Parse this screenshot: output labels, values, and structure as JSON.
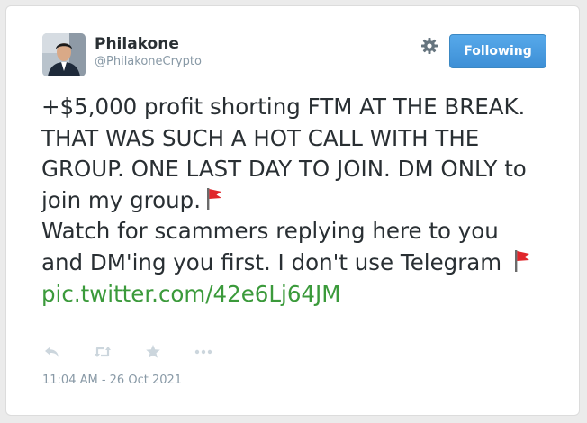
{
  "user": {
    "name": "Philakone",
    "handle": "@PhilakoneCrypto"
  },
  "follow_button": {
    "label": "Following",
    "color": "#4a9ee0"
  },
  "tweet": {
    "line1": "+$5,000 profit shorting FTM AT THE BREAK. THAT WAS SUCH A HOT CALL WITH THE GROUP. ONE LAST DAY TO JOIN. DM ONLY to join my group.",
    "line2": "Watch for scammers replying here to you and DM'ing you first. I don't use Telegram",
    "link": "pic.twitter.com/42e6Lj64JM",
    "emoji_icon": "red-flag-icon"
  },
  "timestamp": "11:04 AM - 26 Oct 2021",
  "actions": [
    "reply-icon",
    "retweet-icon",
    "favorite-icon",
    "more-icon"
  ],
  "colors": {
    "link": "#3b9a3b",
    "text": "#292f33",
    "muted": "#8899a6"
  }
}
